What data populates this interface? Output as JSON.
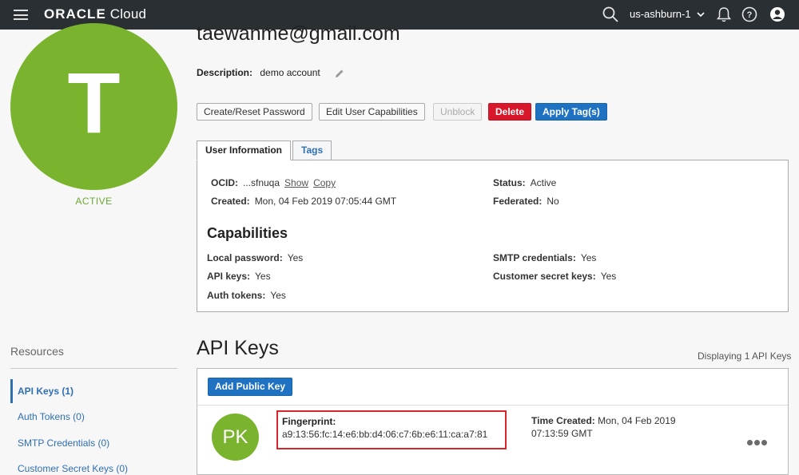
{
  "header": {
    "brand_oracle": "ORACLE",
    "brand_cloud": "Cloud",
    "region": "us-ashburn-1",
    "icons": [
      "menu-icon",
      "search-icon",
      "chevron-down-icon",
      "bell-icon",
      "help-icon",
      "user-icon"
    ]
  },
  "user": {
    "avatar_letter": "T",
    "status": "ACTIVE",
    "email": "taewanme@gmail.com",
    "description_label": "Description:",
    "description": "demo account"
  },
  "actions": {
    "create_reset_password": "Create/Reset Password",
    "edit_capabilities": "Edit User Capabilities",
    "unblock": "Unblock",
    "delete": "Delete",
    "apply_tags": "Apply Tag(s)"
  },
  "tabs": {
    "user_information": "User Information",
    "tags": "Tags"
  },
  "info": {
    "ocid_label": "OCID:",
    "ocid_value": "...sfnuqa",
    "show_link": "Show",
    "copy_link": "Copy",
    "created_label": "Created:",
    "created_value": "Mon, 04 Feb 2019 07:05:44 GMT",
    "status_label": "Status:",
    "status_value": "Active",
    "federated_label": "Federated:",
    "federated_value": "No"
  },
  "capabilities": {
    "title": "Capabilities",
    "local_password_label": "Local password:",
    "local_password_value": "Yes",
    "api_keys_label": "API keys:",
    "api_keys_value": "Yes",
    "auth_tokens_label": "Auth tokens:",
    "auth_tokens_value": "Yes",
    "smtp_label": "SMTP credentials:",
    "smtp_value": "Yes",
    "customer_secret_label": "Customer secret keys:",
    "customer_secret_value": "Yes"
  },
  "resources": {
    "title": "Resources",
    "items": [
      {
        "label": "API Keys (1)",
        "active": true
      },
      {
        "label": "Auth Tokens (0)",
        "active": false
      },
      {
        "label": "SMTP Credentials (0)",
        "active": false
      },
      {
        "label": "Customer Secret Keys (0)",
        "active": false
      }
    ]
  },
  "api_keys": {
    "title": "API Keys",
    "count_text": "Displaying 1 API Keys",
    "add_button": "Add Public Key",
    "items": [
      {
        "avatar": "PK",
        "fingerprint_label": "Fingerprint:",
        "fingerprint": "a9:13:56:fc:14:e6:bb:d4:06:c7:6b:e6:11:ca:a7:81",
        "time_created_label": "Time Created:",
        "time_created_date": "Mon, 04 Feb 2019",
        "time_created_time": "07:13:59 GMT"
      }
    ]
  },
  "colors": {
    "topbar": "#2a2f33",
    "avatar_green": "#7ab32e",
    "link_blue": "#2f6fb4",
    "delete_red": "#d8172a",
    "primary_blue": "#1f72c2",
    "highlight_red": "#d7262e"
  }
}
